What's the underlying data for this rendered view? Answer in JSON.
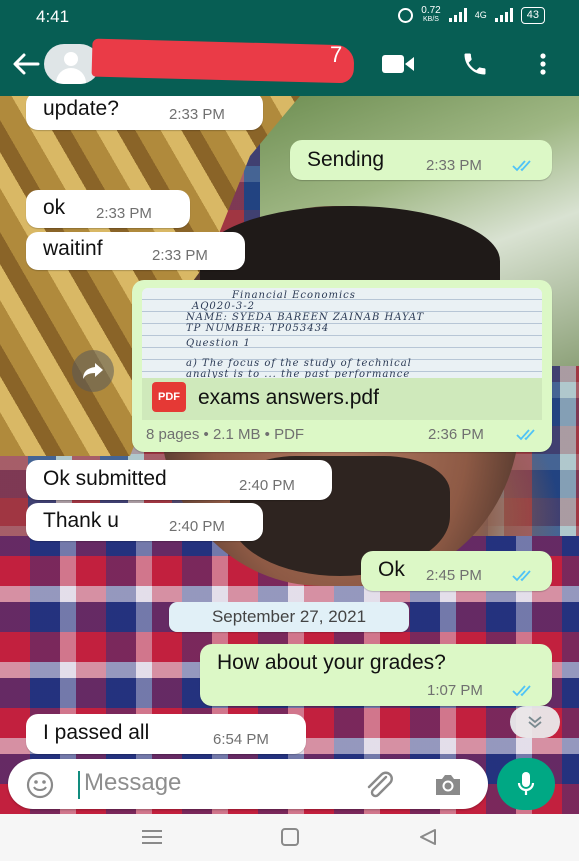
{
  "status_bar": {
    "time": "4:41",
    "speed_value": "0.72",
    "speed_unit": "KB/S",
    "network": "4G",
    "battery": "43"
  },
  "header": {
    "contact_name_visible": "7",
    "icons": [
      "back-arrow-icon",
      "avatar",
      "video-call-icon",
      "voice-call-icon",
      "more-options-icon"
    ]
  },
  "messages": [
    {
      "side": "in",
      "text": "update?",
      "time": "2:33 PM"
    },
    {
      "side": "out",
      "text": "Sending",
      "time": "2:33 PM",
      "status": "read"
    },
    {
      "side": "in",
      "text": "ok",
      "time": "2:33 PM"
    },
    {
      "side": "in",
      "text": "waitinf",
      "time": "2:33 PM"
    },
    {
      "side": "in",
      "text": "Ok submitted",
      "time": "2:40 PM"
    },
    {
      "side": "in",
      "text": "Thank u",
      "time": "2:40 PM"
    },
    {
      "side": "out",
      "text": "Ok",
      "time": "2:45 PM",
      "status": "read"
    },
    {
      "side": "out",
      "text": "How about your grades?",
      "time": "1:07 PM",
      "status": "read"
    },
    {
      "side": "in",
      "text": "I passed all",
      "time": "6:54 PM"
    }
  ],
  "document": {
    "file_name": "exams answers.pdf",
    "badge": "PDF",
    "meta": "8 pages • 2.1 MB • PDF",
    "time": "2:36 PM",
    "status": "read",
    "preview_lines": [
      "Financial Economics",
      "AQ020-3-2",
      "NAME: SYEDA BAREEN ZAINAB HAYAT",
      "TP NUMBER: TP053434",
      "Question 1",
      "a) The focus of the study of technical",
      "analyst is to ... the past performance"
    ]
  },
  "date_separator": "September 27, 2021",
  "composer": {
    "placeholder": "Message"
  },
  "colors": {
    "header": "#075e54",
    "outgoing_bubble": "#dcf8c6",
    "incoming_bubble": "#ffffff",
    "read_ticks": "#4fc3f7",
    "mic_button": "#00a884"
  }
}
